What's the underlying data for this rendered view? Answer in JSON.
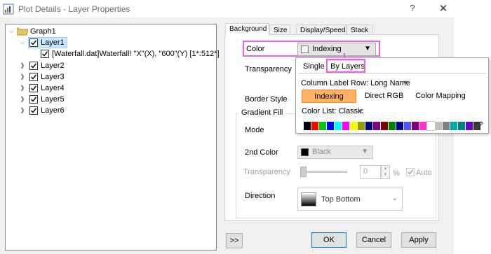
{
  "window": {
    "title": "Plot Details - Layer Properties",
    "help_icon": "?",
    "close_icon": "✕",
    "app_icon": "plot-details-icon"
  },
  "tree": {
    "root": {
      "label": "Graph1",
      "icon": "folder-icon",
      "expanded": true
    },
    "layers": [
      {
        "label": "Layer1",
        "expanded": true,
        "checked": true,
        "selected": true
      },
      {
        "label": "Layer2",
        "expanded": false,
        "checked": true
      },
      {
        "label": "Layer3",
        "expanded": false,
        "checked": true
      },
      {
        "label": "Layer4",
        "expanded": false,
        "checked": true
      },
      {
        "label": "Layer5",
        "expanded": false,
        "checked": true
      },
      {
        "label": "Layer6",
        "expanded": false,
        "checked": true
      }
    ],
    "layer1_child": {
      "label": "[Waterfall.dat]Waterfall! \"X\"(X), \"600\"(Y) [1*:512*]",
      "checked": true
    }
  },
  "tabs": [
    "Background",
    "Size",
    "Display/Speed",
    "Stack"
  ],
  "background": {
    "color_label": "Color",
    "color_value": "Indexing",
    "transparency_label": "Transparency",
    "border_style_label": "Border Style",
    "gradient_fill_label": "Gradient Fill",
    "mode_label": "Mode",
    "second_color_label": "2nd Color",
    "second_color_value": "Black",
    "transparency2_label": "Transparency",
    "transparency2_value": "0",
    "percent": "%",
    "auto_label": "Auto",
    "direction_label": "Direction",
    "direction_value": "Top Bottom"
  },
  "popup": {
    "tabs": [
      "Single",
      "By Layers"
    ],
    "active_tab": "By Layers",
    "column_label_row": "Column Label Row: Long Name",
    "buttons": [
      "Indexing",
      "Direct RGB",
      "Color Mapping"
    ],
    "active_button": "Indexing",
    "color_list": "Color List: Classic",
    "palette": [
      "#000000",
      "#ff0000",
      "#00cc00",
      "#0000ff",
      "#00ffff",
      "#ff00ff",
      "#ffff00",
      "#999900",
      "#000080",
      "#800080",
      "#800000",
      "#008000",
      "#000099",
      "#5555ff",
      "#800080",
      "#ff33cc",
      "#ffffff",
      "#c0c0c0",
      "#808080",
      "#00aaaa",
      "#008080",
      "#6600cc",
      "#333333"
    ],
    "edit_icon": "pencil-icon"
  },
  "buttons": {
    "expand": ">>",
    "ok": "OK",
    "cancel": "Cancel",
    "apply": "Apply"
  },
  "colors": {
    "highlight_pink": "#e861e8",
    "active_orange": "#ffb266",
    "selection_blue": "#cce8ff"
  }
}
